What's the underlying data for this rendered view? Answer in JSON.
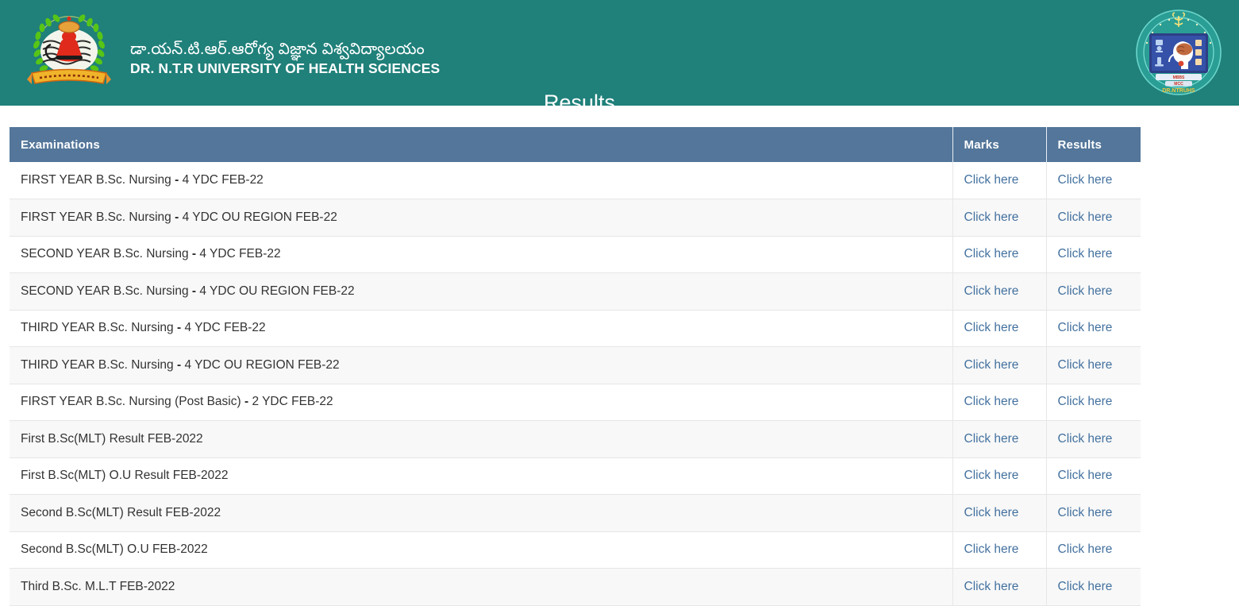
{
  "header": {
    "brand_te": "డా.యన్.టి.ఆర్.ఆరోగ్య విజ్ఞాన విశ్వవిద్యాలయం",
    "brand_en": "DR. N.T.R UNIVERSITY OF HEALTH SCIENCES",
    "page_title": "Results",
    "background_color": "#20807a",
    "left_logo_name": "university-crest-logo",
    "right_logo_name": "university-seal-logo"
  },
  "table": {
    "accent_color": "#53769a",
    "link_color": "#43719f",
    "columns": [
      "Examinations",
      "Marks",
      "Results"
    ],
    "link_label": "Click here",
    "rows": [
      {
        "name": "FIRST YEAR B.Sc. Nursing",
        "sep": " - ",
        "suffix": "4 YDC FEB-22",
        "marks": "Click here",
        "results": "Click here"
      },
      {
        "name": "FIRST YEAR B.Sc. Nursing",
        "sep": " - ",
        "suffix": "4 YDC OU REGION FEB-22",
        "marks": "Click here",
        "results": "Click here"
      },
      {
        "name": "SECOND YEAR B.Sc. Nursing",
        "sep": " - ",
        "suffix": "4 YDC FEB-22",
        "marks": "Click here",
        "results": "Click here"
      },
      {
        "name": "SECOND YEAR B.Sc. Nursing",
        "sep": " - ",
        "suffix": "4 YDC OU REGION FEB-22",
        "marks": "Click here",
        "results": "Click here"
      },
      {
        "name": "THIRD YEAR B.Sc. Nursing",
        "sep": " - ",
        "suffix": "4 YDC FEB-22",
        "marks": "Click here",
        "results": "Click here"
      },
      {
        "name": "THIRD YEAR B.Sc. Nursing",
        "sep": " - ",
        "suffix": "4 YDC OU REGION FEB-22",
        "marks": "Click here",
        "results": "Click here"
      },
      {
        "name": "FIRST YEAR B.Sc. Nursing (Post Basic)",
        "sep": " - ",
        "suffix": "2 YDC FEB-22",
        "marks": "Click here",
        "results": "Click here"
      },
      {
        "name": "First B.Sc(MLT) Result FEB-2022",
        "sep": "",
        "suffix": "",
        "marks": "Click here",
        "results": "Click here"
      },
      {
        "name": "First B.Sc(MLT) O.U Result FEB-2022",
        "sep": "",
        "suffix": "",
        "marks": "Click here",
        "results": "Click here"
      },
      {
        "name": "Second B.Sc(MLT) Result FEB-2022",
        "sep": "",
        "suffix": "",
        "marks": "Click here",
        "results": "Click here"
      },
      {
        "name": "Second B.Sc(MLT) O.U FEB-2022",
        "sep": "",
        "suffix": "",
        "marks": "Click here",
        "results": "Click here"
      },
      {
        "name": "Third B.Sc. M.L.T FEB-2022",
        "sep": "",
        "suffix": "",
        "marks": "Click here",
        "results": "Click here"
      }
    ]
  }
}
